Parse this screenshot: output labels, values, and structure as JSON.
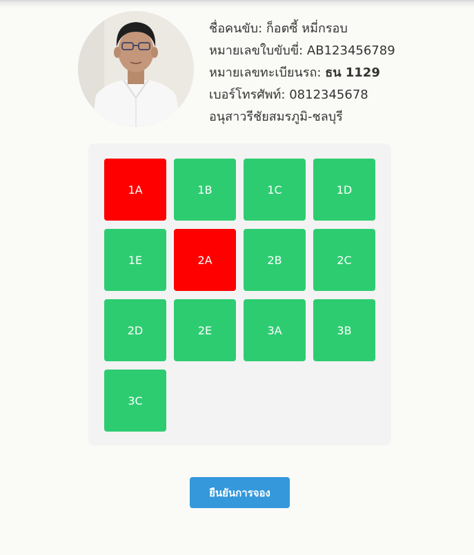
{
  "driver": {
    "name_label": "ชื่อคนขับ:",
    "name_value": "ก็อตซี้ หมี่กรอบ",
    "license_label": "หมายเลขใบขับขี่:",
    "license_value": "AB123456789",
    "plate_label": "หมายเลขทะเบียนรถ:",
    "plate_value": "ธน 1129",
    "phone_label": "เบอร์โทรศัพท์:",
    "phone_value": "0812345678",
    "route": "อนุสาวรีชัยสมรภูมิ-ชลบุรี"
  },
  "seats": [
    {
      "label": "1A",
      "status": "booked"
    },
    {
      "label": "1B",
      "status": "available"
    },
    {
      "label": "1C",
      "status": "available"
    },
    {
      "label": "1D",
      "status": "available"
    },
    {
      "label": "1E",
      "status": "available"
    },
    {
      "label": "2A",
      "status": "booked"
    },
    {
      "label": "2B",
      "status": "available"
    },
    {
      "label": "2C",
      "status": "available"
    },
    {
      "label": "2D",
      "status": "available"
    },
    {
      "label": "2E",
      "status": "available"
    },
    {
      "label": "3A",
      "status": "available"
    },
    {
      "label": "3B",
      "status": "available"
    },
    {
      "label": "3C",
      "status": "available"
    }
  ],
  "colors": {
    "available": "#2ecc71",
    "booked": "#ff0000",
    "primary_button": "#3498db"
  },
  "confirm_label": "ยืนยันการจอง"
}
